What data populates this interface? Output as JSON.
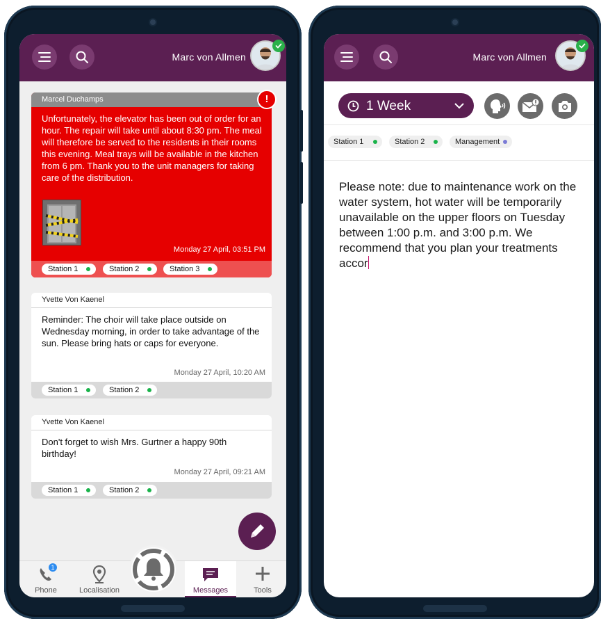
{
  "user": {
    "name": "Marc von Allmen",
    "status": "online"
  },
  "colors": {
    "brand": "#5b1f52",
    "urgent": "#e60000",
    "online": "#19b34a",
    "management_dot": "#7b7bd6"
  },
  "left_screen": {
    "messages": [
      {
        "author": "Marcel Duchamps",
        "urgent": true,
        "alert_symbol": "!",
        "body": "Unfortunately, the elevator has been out of order for an hour. The repair will take until about 8:30 pm. The meal will therefore be served to the residents in their rooms this evening. Meal trays will be available in the kitchen from 6 pm. Thank you to the unit managers for taking care of the distribution.",
        "time": "Monday 27 April, 03:51 PM",
        "tags": [
          "Station 1",
          "Station 2",
          "Station 3"
        ]
      },
      {
        "author": "Yvette Von Kaenel",
        "urgent": false,
        "body": "Reminder: The choir will take place outside on Wednesday morning, in order to take advantage of the sun. Please bring hats or caps for everyone.",
        "time": "Monday 27 April, 10:20 AM",
        "tags": [
          "Station 1",
          "Station 2"
        ]
      },
      {
        "author": "Yvette Von Kaenel",
        "urgent": false,
        "body": "Don't forget to wish Mrs. Gurtner a happy 90th birthday!",
        "time": "Monday 27 April, 09:21 AM",
        "tags": [
          "Station 1",
          "Station 2"
        ]
      }
    ],
    "nav": {
      "phone": {
        "label": "Phone",
        "badge": "1",
        "icon": "phone-icon"
      },
      "localisation": {
        "label": "Localisation",
        "icon": "location-pin-icon"
      },
      "messages": {
        "label": "Messages",
        "icon": "message-icon",
        "active": true
      },
      "tools": {
        "label": "Tools",
        "icon": "plus-icon"
      }
    }
  },
  "right_screen": {
    "period_selector": {
      "label": "1 Week",
      "icon": "clock-icon"
    },
    "stations": [
      {
        "label": "Station 1",
        "dot": "#19b34a"
      },
      {
        "label": "Station 2",
        "dot": "#19b34a"
      },
      {
        "label": "Management",
        "dot": "#7b7bd6"
      }
    ],
    "compose_text": "Please note: due to maintenance work on the water system, hot water will be temporarily unavailable on the upper floors on Tuesday between 1:00 p.m. and 3:00 p.m. We recommend that you plan your treatments accor"
  }
}
